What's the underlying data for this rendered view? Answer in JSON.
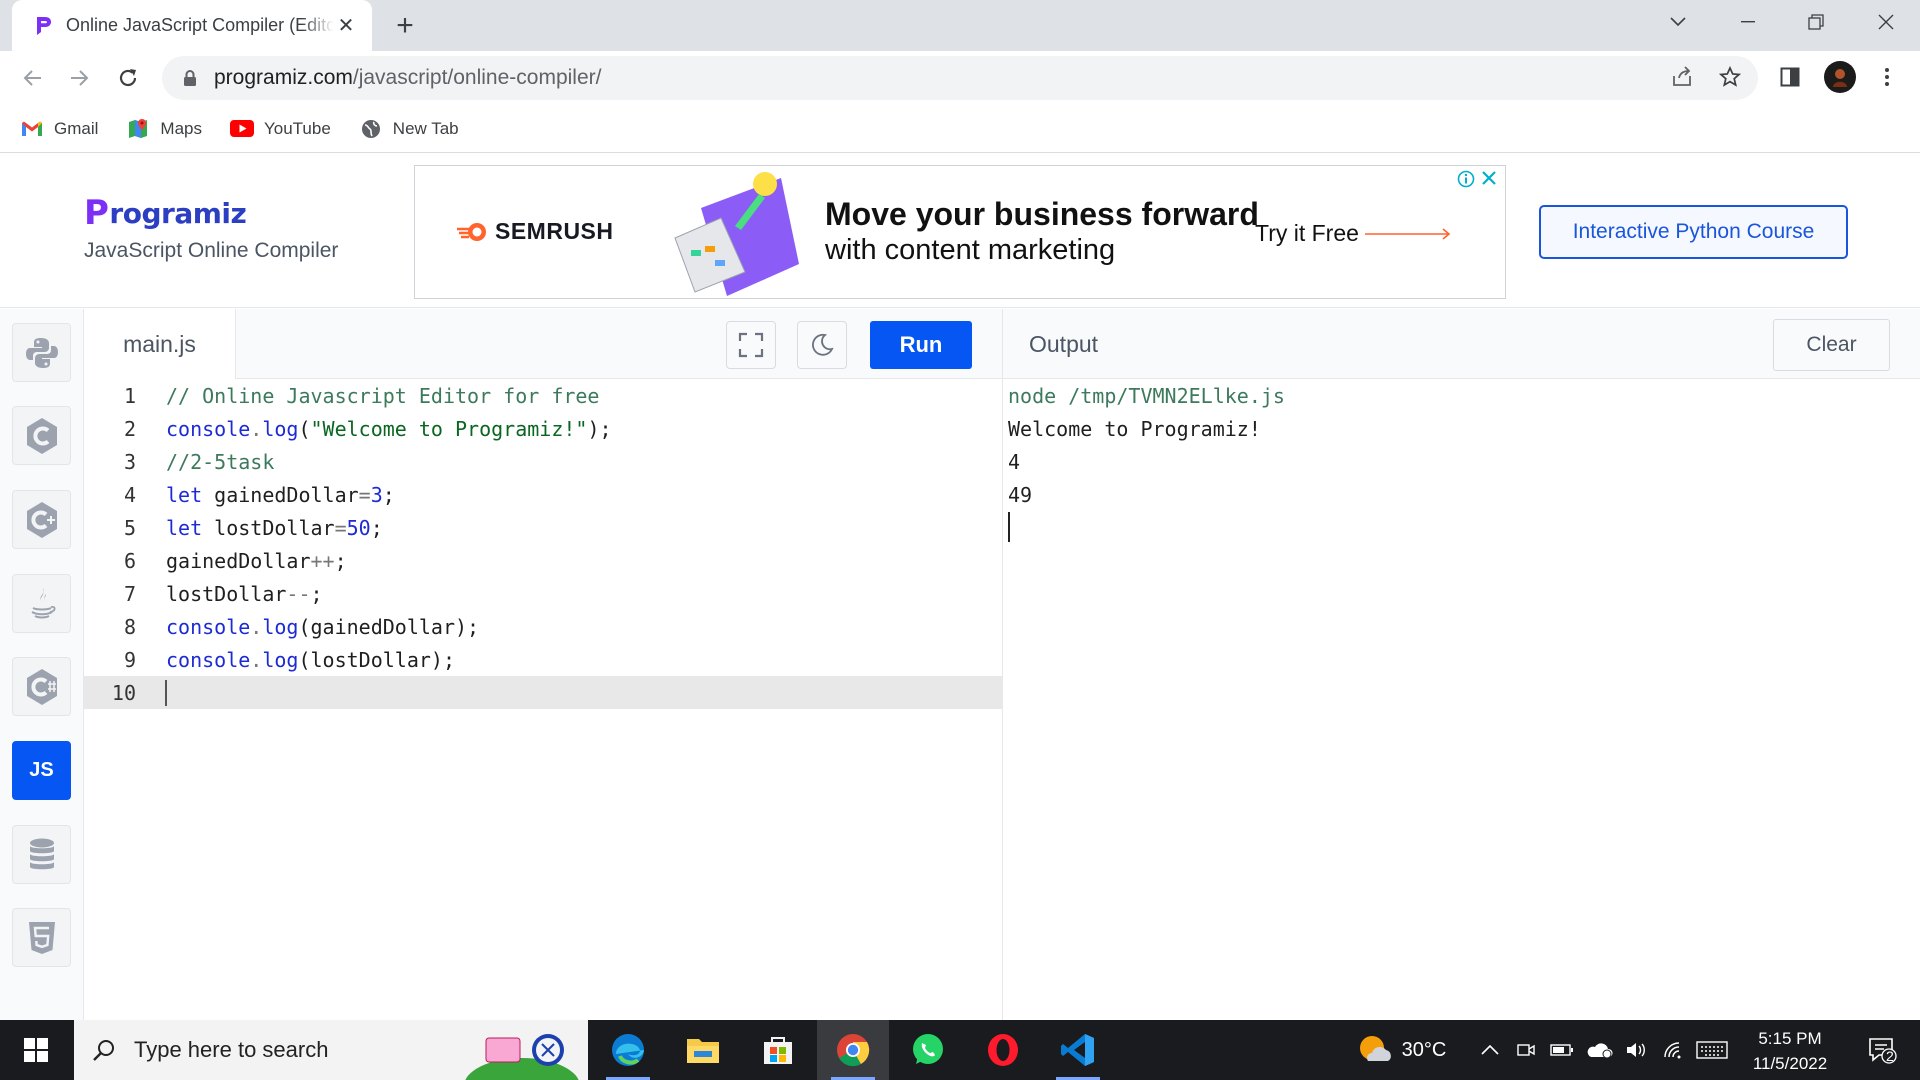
{
  "browser": {
    "tab_title": "Online JavaScript Compiler (Editor)",
    "url_domain": "programiz.com",
    "url_path": "/javascript/online-compiler/",
    "bookmarks": [
      {
        "label": "Gmail",
        "icon": "gmail-icon"
      },
      {
        "label": "Maps",
        "icon": "maps-icon"
      },
      {
        "label": "YouTube",
        "icon": "youtube-icon"
      },
      {
        "label": "New Tab",
        "icon": "globe-icon"
      }
    ]
  },
  "site": {
    "logo_text": "rogramiz",
    "logo_letter": "P",
    "subtitle": "JavaScript Online Compiler",
    "course_button": "Interactive Python Course"
  },
  "ad": {
    "brand": "SEMRUSH",
    "headline": "Move your business forward",
    "subline": "with content marketing",
    "cta": "Try it Free"
  },
  "languages": [
    {
      "name": "python-icon",
      "active": false
    },
    {
      "name": "c-icon",
      "active": false
    },
    {
      "name": "cpp-icon",
      "active": false
    },
    {
      "name": "java-icon",
      "active": false
    },
    {
      "name": "csharp-icon",
      "active": false
    },
    {
      "name": "javascript-icon",
      "label": "JS",
      "active": true
    },
    {
      "name": "sql-icon",
      "active": false
    },
    {
      "name": "html5-icon",
      "active": false
    }
  ],
  "editor": {
    "filename": "main.js",
    "run_label": "Run",
    "current_line": 10,
    "lines": [
      "// Online Javascript Editor for free",
      "console.log(\"Welcome to Programiz!\");",
      "//2-5task",
      "let gainedDollar=3;",
      "let lostDollar=50;",
      "gainedDollar++;",
      "lostDollar--;",
      "console.log(gainedDollar);",
      "console.log(lostDollar);",
      ""
    ]
  },
  "output": {
    "label": "Output",
    "clear_label": "Clear",
    "lines": [
      "node /tmp/TVMN2ELlke.js",
      "Welcome to Programiz!",
      "4",
      "49"
    ]
  },
  "taskbar": {
    "search_placeholder": "Type here to search",
    "temperature": "30°C",
    "time": "5:15 PM",
    "date": "11/5/2022",
    "notification_count": "2"
  },
  "colors": {
    "accent": "#0556f3",
    "brand": "#2c3ec2"
  }
}
